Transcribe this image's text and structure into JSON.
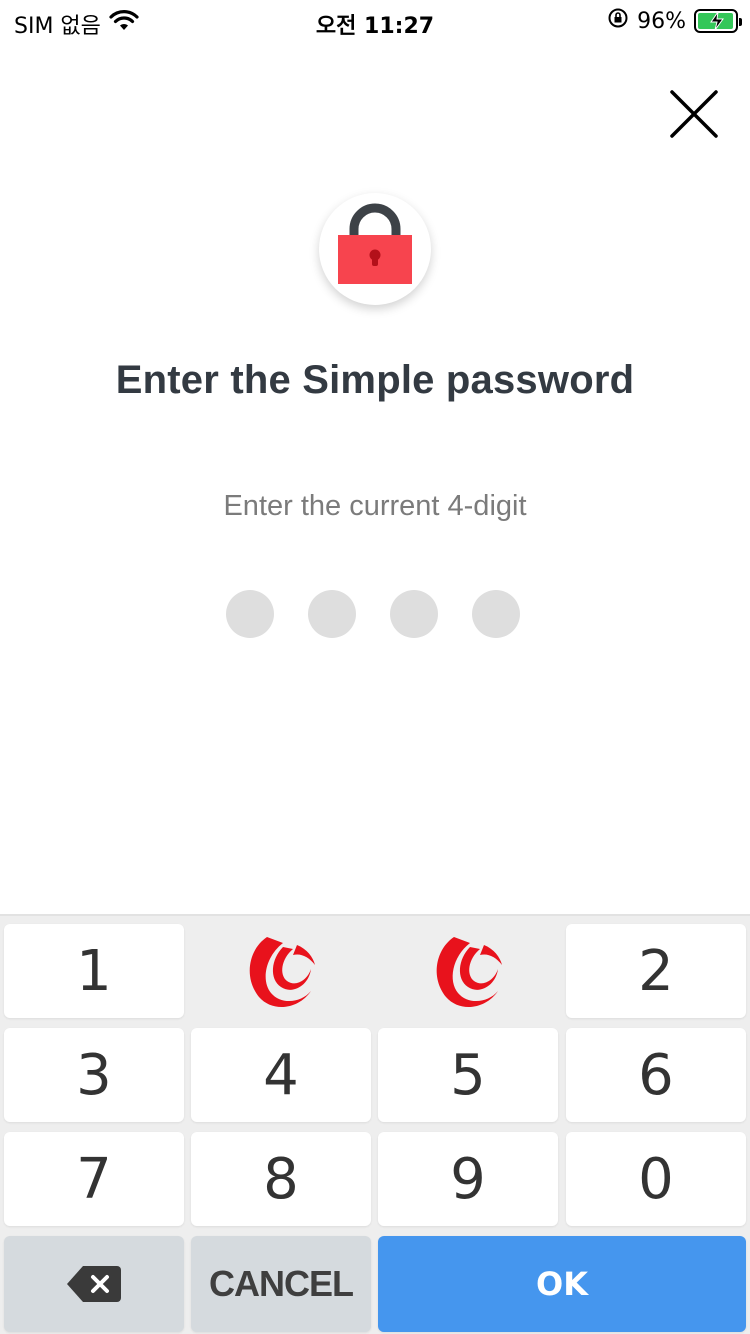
{
  "status_bar": {
    "carrier": "SIM 없음",
    "time": "오전 11:27",
    "battery": "96%",
    "battery_level": 0.96
  },
  "header": {
    "close_icon": "close-icon"
  },
  "lock": {
    "icon": "lock-icon",
    "color": "#f7444e"
  },
  "title": "Enter the Simple password",
  "subtitle": "Enter the current 4-digit",
  "pin": {
    "length": 4,
    "entered": 0
  },
  "keypad": {
    "row1": [
      "1",
      "2"
    ],
    "row2": [
      "3",
      "4",
      "5",
      "6"
    ],
    "row3": [
      "7",
      "8",
      "9",
      "0"
    ],
    "cancel": "CANCEL",
    "ok": "OK",
    "backspace_icon": "backspace-icon",
    "logo_icon": "brand-logo-icon"
  },
  "colors": {
    "accent": "#4596ee",
    "title": "#333a42",
    "logo": "#e8121c"
  }
}
